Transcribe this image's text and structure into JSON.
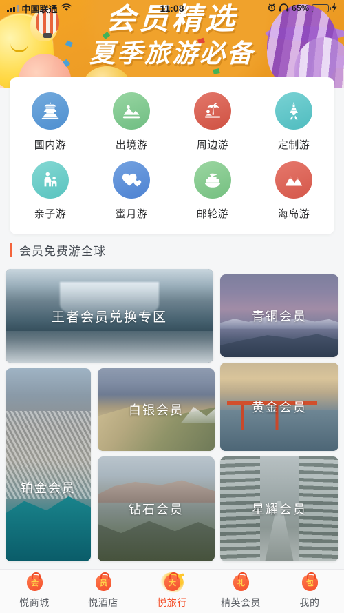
{
  "status_bar": {
    "carrier": "中国联通",
    "time": "11:08",
    "battery_percent": "65%",
    "battery_level": 65,
    "icons": [
      "signal-icon",
      "wifi-icon",
      "location-arrow-icon",
      "alarm-icon",
      "headphones-icon",
      "battery-icon",
      "charging-icon"
    ]
  },
  "banner": {
    "line1": "会员精选",
    "line2": "夏季旅游必备",
    "background_color": "#f0a22c"
  },
  "quick_nav": {
    "items": [
      {
        "label": "国内游",
        "icon": "pagoda-icon",
        "color": "#5b9bd5"
      },
      {
        "label": "出境游",
        "icon": "mountain-photo-icon",
        "color": "#7fc48a"
      },
      {
        "label": "周边游",
        "icon": "palm-beach-icon",
        "color": "#d9614f"
      },
      {
        "label": "定制游",
        "icon": "eiffel-tower-icon",
        "color": "#63c7c9"
      },
      {
        "label": "亲子游",
        "icon": "parent-child-icon",
        "color": "#6ecbc7"
      },
      {
        "label": "蜜月游",
        "icon": "hearts-icon",
        "color": "#5b8ed6"
      },
      {
        "label": "邮轮游",
        "icon": "cruise-ship-icon",
        "color": "#8ecb94"
      },
      {
        "label": "海岛游",
        "icon": "island-peaks-icon",
        "color": "#dd6356"
      }
    ]
  },
  "section": {
    "title": "会员免费游全球",
    "accent_color": "#f4643c"
  },
  "cards": [
    {
      "label": "王者会员兑换专区",
      "photo": "waterfall-snow",
      "span": "wide"
    },
    {
      "label": "青铜会员",
      "photo": "dusk-mountains",
      "span": "normal"
    },
    {
      "label": "铂金会员",
      "photo": "coastal-city",
      "span": "tall"
    },
    {
      "label": "白银会员",
      "photo": "volcanic-ridge",
      "span": "normal"
    },
    {
      "label": "黄金会员",
      "photo": "golden-gate-bridge",
      "span": "normal"
    },
    {
      "label": "钻石会员",
      "photo": "rocky-shore",
      "span": "normal"
    },
    {
      "label": "星耀会员",
      "photo": "snowy-forest-road",
      "span": "normal"
    }
  ],
  "tabbar": {
    "active_index": 2,
    "active_color": "#f4502b",
    "inactive_color": "#5c6066",
    "items": [
      {
        "label": "悦商城",
        "badge": "会",
        "icon": "money-bag-icon"
      },
      {
        "label": "悦酒店",
        "badge": "员",
        "icon": "money-bag-icon"
      },
      {
        "label": "悦旅行",
        "badge": "大",
        "icon": "money-bag-glow-icon"
      },
      {
        "label": "精英会员",
        "badge": "礼",
        "icon": "money-bag-icon"
      },
      {
        "label": "我的",
        "badge": "包",
        "icon": "money-bag-icon"
      }
    ]
  }
}
